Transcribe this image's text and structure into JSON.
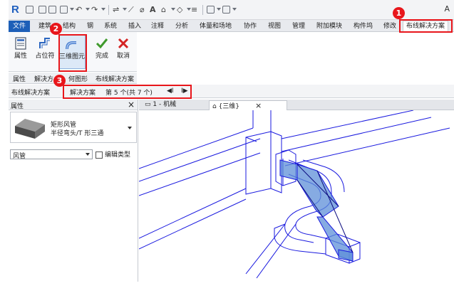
{
  "quick_access": {
    "user_initial": "A"
  },
  "ribbon_tabs": [
    {
      "label": "文件"
    },
    {
      "label": "建筑"
    },
    {
      "label": "结构"
    },
    {
      "label": "钢"
    },
    {
      "label": "系统"
    },
    {
      "label": "插入"
    },
    {
      "label": "注释"
    },
    {
      "label": "分析"
    },
    {
      "label": "体量和场地"
    },
    {
      "label": "协作"
    },
    {
      "label": "视图"
    },
    {
      "label": "管理"
    },
    {
      "label": "附加模块"
    },
    {
      "label": "构件坞"
    },
    {
      "label": "修改"
    },
    {
      "label": "布线解决方案"
    }
  ],
  "ribbon_buttons": {
    "properties": "属性",
    "placeholder": "占位符",
    "three_d_element": "三维图元",
    "finish": "完成",
    "cancel": "取消"
  },
  "panel_labels": {
    "properties": "属性",
    "solution": "解决方",
    "geometry": "何图形",
    "routing": "布线解决方案"
  },
  "context_bar": {
    "title": "布线解决方案",
    "solution_label": "解决方案",
    "position_text": "第 5 个(共 7 个)",
    "prev_glyph": "◀I",
    "next_glyph": "I▶"
  },
  "properties_panel": {
    "title": "属性",
    "type_name_1": "矩形风管",
    "type_name_2": "半径弯头/T 形三通",
    "filter_value": "风管",
    "edit_type_label": "编辑类型"
  },
  "view_tabs": [
    {
      "label": "1 - 机械"
    },
    {
      "label": "{三维}"
    }
  ],
  "markers": [
    "1",
    "2",
    "3"
  ],
  "colors": {
    "accent": "#1d5fb8",
    "annotation_red": "#e8161b",
    "duct_blue": "#1a1adf",
    "duct_fill": "#5d8fd8"
  },
  "icons": {
    "app_logo": "revit-logo-icon",
    "check": "check-icon",
    "cancel": "x-icon",
    "duct_3d": "duct-3d-icon"
  }
}
